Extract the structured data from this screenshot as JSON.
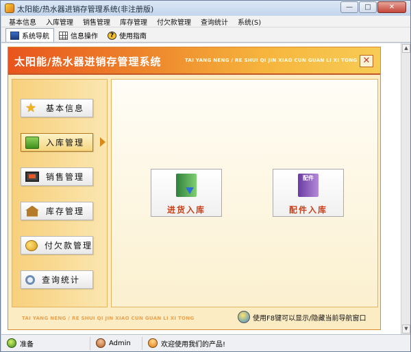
{
  "window": {
    "title": "太阳能/热水器进销存管理系统(非注册版)",
    "buttons": {
      "minimize": "—",
      "maximize": "□",
      "close": "✕"
    }
  },
  "menu": [
    "基本信息",
    "入库管理",
    "销售管理",
    "库存管理",
    "付欠款管理",
    "查询统计",
    "系统(S)"
  ],
  "toolbar": {
    "tabs": [
      {
        "label": "系统导航",
        "icon": "nav-icon",
        "active": true
      },
      {
        "label": "信息操作",
        "icon": "grid-icon",
        "active": false
      },
      {
        "label": "使用指南",
        "icon": "help-icon",
        "active": false
      }
    ]
  },
  "panel": {
    "title": "太阳能/热水器进销存管理系统",
    "pinyin": "TAI YANG NENG / RE SHUI QI JIN XIAO CUN GUAN LI XI TONG",
    "close_label": "✕",
    "sidebar": [
      {
        "label": "基本信息",
        "icon": "star-icon"
      },
      {
        "label": "入库管理",
        "icon": "home-icon",
        "active": true
      },
      {
        "label": "销售管理",
        "icon": "monitor-icon"
      },
      {
        "label": "库存管理",
        "icon": "house-icon"
      },
      {
        "label": "付欠款管理",
        "icon": "coins-icon"
      },
      {
        "label": "查询统计",
        "icon": "magnifier-icon"
      }
    ],
    "functions": [
      {
        "label": "进货入库",
        "icon": "folder-download-icon"
      },
      {
        "label": "配件入库",
        "icon": "parts-icon",
        "icon_text": "配件"
      }
    ],
    "footer_pinyin": "TAI YANG NENG / RE SHUI QI JIN XIAO CUN GUAN LI XI TONG",
    "tip": "使用F8键可以显示/隐藏当前导航窗口"
  },
  "status": {
    "ready": "准备",
    "user": "Admin",
    "welcome": "欢迎使用我们的产品!"
  },
  "colors": {
    "banner_start": "#e8551d",
    "banner_end": "#f7cc55",
    "function_label": "#c8401a",
    "panel_bg": "#fbecc4"
  }
}
